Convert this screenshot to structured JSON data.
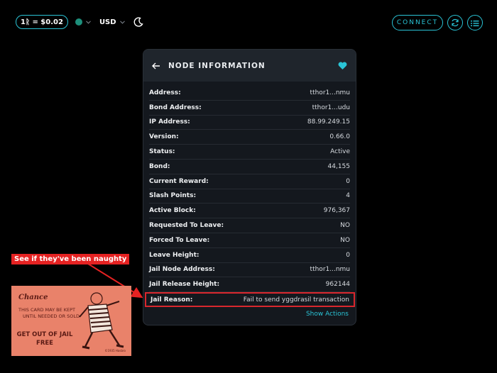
{
  "header": {
    "price_label": "1ᚱ = $0.02",
    "currency": "USD",
    "connect_label": "CONNECT",
    "colors": {
      "accent": "#2ac4d6",
      "network_dot": "#1d8f7b"
    }
  },
  "card": {
    "title": "NODE INFORMATION",
    "rows": [
      {
        "label": "Address:",
        "value": "tthor1...nmu"
      },
      {
        "label": "Bond Address:",
        "value": "tthor1...udu"
      },
      {
        "label": "IP Address:",
        "value": "88.99.249.15"
      },
      {
        "label": "Version:",
        "value": "0.66.0"
      },
      {
        "label": "Status:",
        "value": "Active"
      },
      {
        "label": "Bond:",
        "value": "44,155"
      },
      {
        "label": "Current Reward:",
        "value": "0"
      },
      {
        "label": "Slash Points:",
        "value": "4"
      },
      {
        "label": "Active Block:",
        "value": "976,367"
      },
      {
        "label": "Requested To Leave:",
        "value": "NO"
      },
      {
        "label": "Forced To Leave:",
        "value": "NO"
      },
      {
        "label": "Leave Height:",
        "value": "0"
      },
      {
        "label": "Jail Node Address:",
        "value": "tthor1...nmu"
      },
      {
        "label": "Jail Release Height:",
        "value": "962144"
      },
      {
        "label": "Jail Reason:",
        "value": "Fail to send yggdrasil transaction"
      }
    ],
    "actions_label": "Show Actions"
  },
  "annotation": {
    "note": "See if they've been naughty",
    "highlight_color": "#d9272d"
  },
  "chance_card": {
    "title": "Chance",
    "line1": "THIS CARD MAY BE KEPT",
    "line2": "UNTIL NEEDED OR SOLD",
    "line3": "GET OUT OF JAIL",
    "line4": "FREE",
    "copyright": "©1935 Hasbro"
  }
}
